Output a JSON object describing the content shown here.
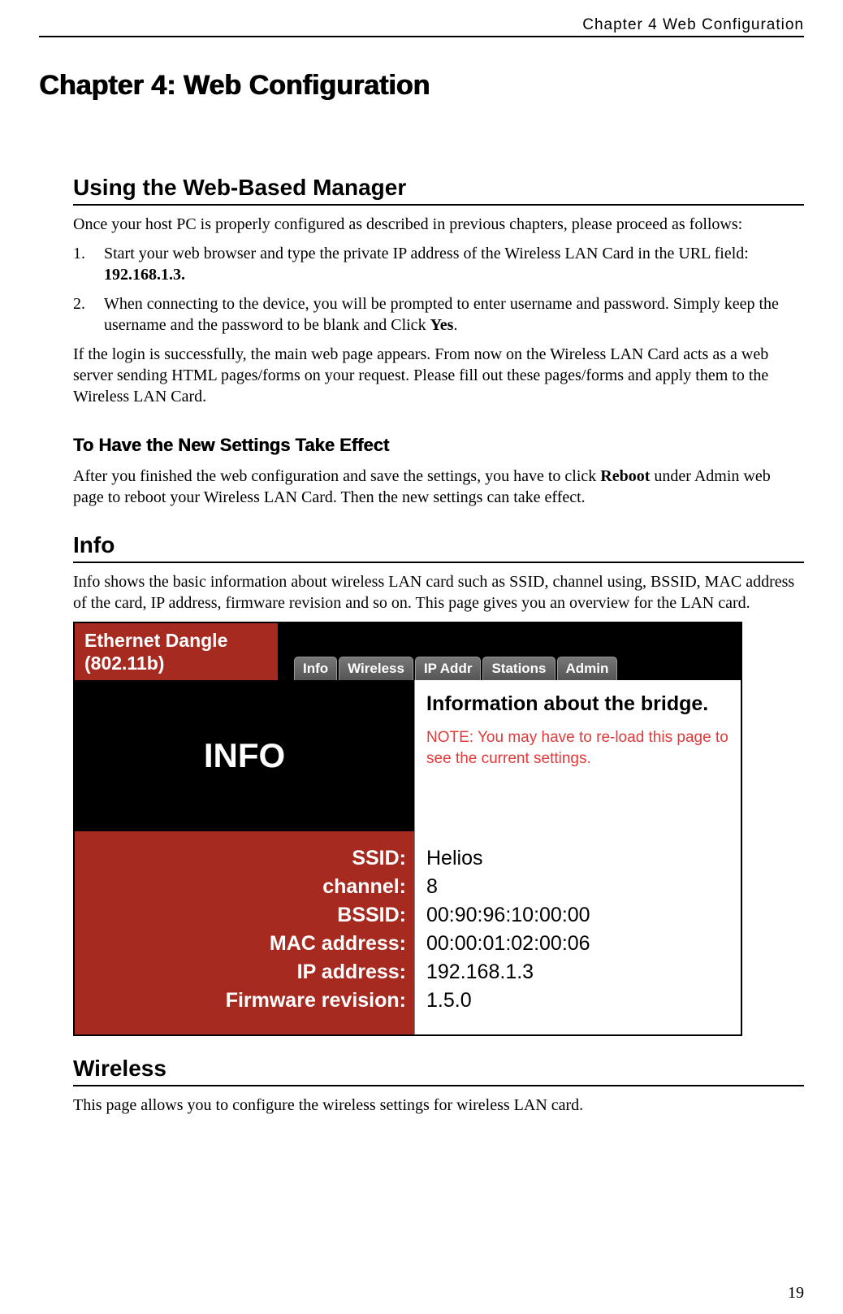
{
  "header": {
    "running": "Chapter 4 Web Configuration",
    "chapter_title": "Chapter 4: Web Configuration"
  },
  "section1": {
    "heading": "Using the Web-Based Manager",
    "intro": "Once your host PC is properly configured as described in previous chapters, please proceed as follows:",
    "step1_a": "Start your web browser and type the private IP address of the Wireless LAN Card in the URL field: ",
    "step1_b": "192.168.1.3.",
    "step2_a": "When connecting to the device, you will be prompted to enter username and password. Simply keep the username and the password to be blank and Click ",
    "step2_b": "Yes",
    "step2_c": ".",
    "post": "If the login is successfully, the main web page appears. From now on the Wireless LAN Card acts as a web server sending HTML pages/forms on your request. Please fill out these pages/forms and apply them to the Wireless LAN Card."
  },
  "section2": {
    "heading": "To Have the New Settings Take Effect",
    "p_a": "After you finished the web configuration and save the settings, you have to click ",
    "p_b": "Reboot",
    "p_c": " under Admin web page to reboot your Wireless LAN Card. Then the new settings can take effect."
  },
  "section3": {
    "heading": "Info",
    "intro": "Info shows the basic information about wireless LAN card such as SSID, channel using, BSSID, MAC address of the card, IP address, firmware revision and so on. This page gives you an overview for the LAN card."
  },
  "screenshot": {
    "title_line1": "Ethernet Dangle",
    "title_line2": "(802.11b)",
    "tabs": [
      "Info",
      "Wireless",
      "IP Addr",
      "Stations",
      "Admin"
    ],
    "big_label": "INFO",
    "desc_title": "Information about the bridge.",
    "note": "NOTE: You may have to re-load this page to see the current settings.",
    "fields": [
      {
        "label": "SSID:",
        "value": "Helios"
      },
      {
        "label": "channel:",
        "value": "8"
      },
      {
        "label": "BSSID:",
        "value": "00:90:96:10:00:00"
      },
      {
        "label": "MAC address:",
        "value": "00:00:01:02:00:06"
      },
      {
        "label": "IP address:",
        "value": "192.168.1.3"
      },
      {
        "label": "Firmware revision:",
        "value": "1.5.0"
      }
    ]
  },
  "section4": {
    "heading": "Wireless",
    "intro": "This page allows you to configure the wireless settings for wireless LAN card."
  },
  "page_number": "19"
}
